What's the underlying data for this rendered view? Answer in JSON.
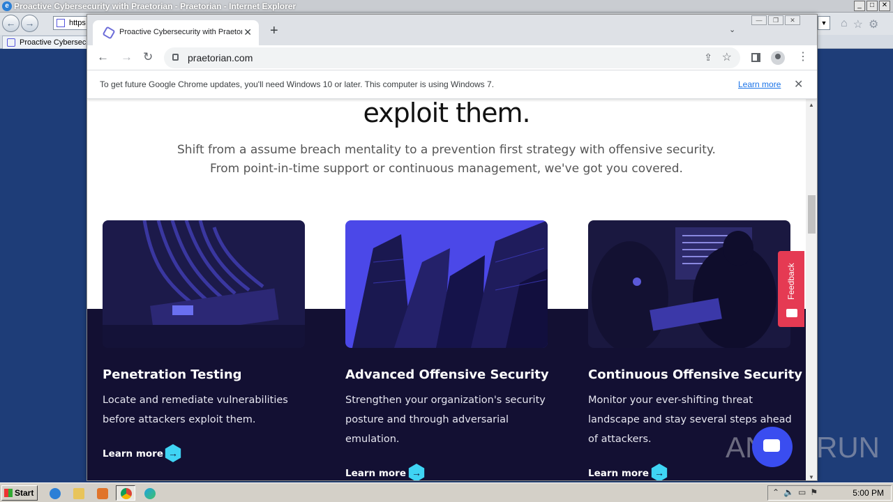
{
  "ie": {
    "title": "Proactive Cybersecurity with Praetorian - Praetorian - Internet Explorer",
    "address_text": "https",
    "tab_label": "Proactive Cybersecu",
    "window_controls": [
      "_",
      "□",
      "✕"
    ]
  },
  "chrome": {
    "tab_title": "Proactive Cybersecurity with Praetorian",
    "tab_close": "✕",
    "new_tab": "+",
    "tab_search": "⌄",
    "url": "praetorian.com",
    "infobar_message": "To get future Google Chrome updates, you'll need Windows 10 or later. This computer is using Windows 7.",
    "infobar_link": "Learn more",
    "infobar_close": "✕"
  },
  "page": {
    "headline": "exploit them.",
    "subhead": "Shift from a assume breach mentality to a prevention first strategy with offensive security. From point-in-time support or continuous management, we've got you covered.",
    "cards": [
      {
        "title": "Penetration Testing",
        "description": "Locate and remediate vulnerabilities before attackers exploit them.",
        "link": "Learn more"
      },
      {
        "title": "Advanced Offensive Security",
        "description": "Strengthen your organization's security posture and through adversarial emulation.",
        "link": "Learn more"
      },
      {
        "title": "Continuous Offensive Security",
        "description": "Monitor your ever-shifting threat landscape and stay several steps ahead of attackers.",
        "link": "Learn more"
      }
    ],
    "feedback_label": "Feedback",
    "accent_color": "#3fd4f4",
    "dark_band_color": "#131033",
    "feedback_color": "#e53a53"
  },
  "watermark": {
    "left": "ANY",
    "right": "RUN"
  },
  "taskbar": {
    "start_label": "Start",
    "clock": "5:00 PM"
  }
}
